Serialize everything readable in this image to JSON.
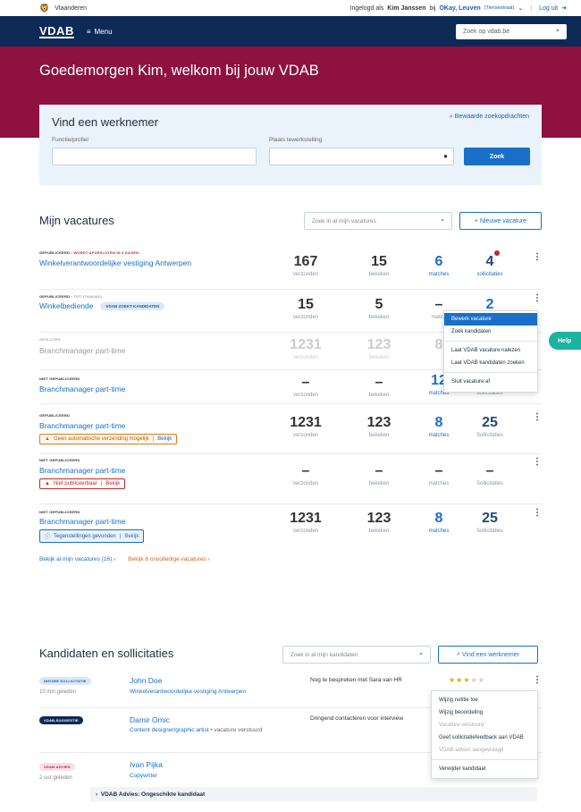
{
  "topbar": {
    "brand": "Vlaanderen",
    "logged_in_prefix": "Ingelogd als",
    "user": "Kim Janssen",
    "at": "bij",
    "org": "OKay, Leuven",
    "org_sub": "(Tiensestraat)",
    "logout": "Log uit"
  },
  "nav": {
    "logo": "VDAB",
    "menu": "Menu",
    "search_placeholder": "Zoek op vdab.be"
  },
  "hero": {
    "greeting": "Goedemorgen Kim, welkom bij jouw VDAB"
  },
  "search": {
    "title": "Vind een werknemer",
    "saved": "Bewaarde zoekopdrachten",
    "function_label": "Functie/profiel",
    "place_label": "Plaats tewerkstelling",
    "button": "Zoek"
  },
  "vacatures": {
    "title": "Mijn vacatures",
    "search_placeholder": "Zoek in al mijn vacatures",
    "new_button": "+ Nieuwe vacature",
    "rows": [
      {
        "status": "GEPUBLICEERD",
        "status_extra": "• WORDT AFGESLOTEN IN 4 DAGEN",
        "title": "Winkelverantwoordelijke vestiging Antwerpen",
        "verzonden": "167",
        "bekeken": "15",
        "matches": "6",
        "sollicitaties": "4",
        "l1": "verzonden",
        "l2": "bekeken",
        "l3": "matches",
        "l4": "sollicitaties"
      },
      {
        "status": "GEPUBLICEERD",
        "status_extra": "• TOT 17/04/2021",
        "title": "Winkelbediende",
        "badge": "VDAB ZOEKT KANDIDATEN",
        "verzonden": "15",
        "bekeken": "5",
        "matches": "–",
        "sollicitaties": "2",
        "l1": "verzonden",
        "l2": "bekeken",
        "l3": "match"
      },
      {
        "status": "GESLOTEN",
        "title": "Branchmanager part-time",
        "verzonden": "1231",
        "bekeken": "123",
        "matches": "8",
        "l1": "verzonden",
        "l2": "bekeken"
      },
      {
        "status": "NIET GEPUBLICEERD",
        "title": "Branchmanager part-time",
        "verzonden": "–",
        "bekeken": "–",
        "matches": "12",
        "l1": "verzonden",
        "l2": "bekeken",
        "l3": "matches",
        "l4": "sollicitaties"
      },
      {
        "status": "GEPUBLICEERD",
        "title": "Branchmanager part-time",
        "warning": "Geen automatische verzending mogelijk",
        "warning_link": "Bekijk",
        "verzonden": "1231",
        "bekeken": "123",
        "matches": "8",
        "sollicitaties": "25",
        "l1": "verzonden",
        "l2": "bekeken",
        "l3": "matches",
        "l4": "Sollicitaties"
      },
      {
        "status": "NIET GEPUBLICEERD",
        "title": "Branchmanager part-time",
        "warning": "Niet publiceerbaar",
        "warning_link": "Bekijk",
        "verzonden": "–",
        "bekeken": "–",
        "matches": "–",
        "sollicitaties": "–",
        "l1": "verzonden",
        "l2": "bekeken",
        "l3": "matches",
        "l4": "Sollicitaties"
      },
      {
        "status": "NIET GEPUBLICEERD",
        "title": "Branchmanager part-time",
        "warning": "Tegenstellingen gevonden",
        "warning_link": "Bekijk",
        "verzonden": "1231",
        "bekeken": "123",
        "matches": "8",
        "sollicitaties": "25",
        "l1": "verzonden",
        "l2": "bekeken",
        "l3": "matches",
        "l4": "Sollicitaties"
      }
    ],
    "menu": [
      "Bewerk vacature",
      "Zoek kandidaten",
      "Laat VDAB vacature nalezen",
      "Laat VDAB kandidaten zoeken",
      "Sluit vacature af"
    ],
    "link_all": "Bekijk al mijn vacatures (16)",
    "link_incomplete": "Bekijk 6 onvolledige vacatures"
  },
  "help": "Help",
  "kandidaten": {
    "title": "Kandidaten en sollicitaties",
    "search_placeholder": "Zoek in al mijn kandidaten",
    "find_button": "Vind een werknemer",
    "rows": [
      {
        "badge": "NIEUWE SOLLICITATIE",
        "time": "10 min geleden",
        "name": "John Doe",
        "job": "Winkelverantwoordelijke vestiging Antwerpen",
        "note": "Nog te bespreken met Sara van HR",
        "rating": 3
      },
      {
        "badge": "VDAB-SUGGESTIE",
        "name": "Damir Omic",
        "job": "Content designer/graphic artist",
        "job_extra": "vacature verstuurd",
        "note": "Dringend contacteren voor interview"
      },
      {
        "badge": "VDAB-ADVIES",
        "time": "2 uur geleden",
        "name": "Ivan Pijka",
        "job": "Copywriter"
      }
    ],
    "menu": [
      "Wijzig notitie toe",
      "Wijzig beoordeling",
      "Vacature verstuurd",
      "Geef sollicitatiefeedback aan VDAB",
      "VDAB-advies aangevraagd",
      "Verwijder kandidaat"
    ],
    "advice": "VDAB Advies: Ongeschikte kandidaat"
  }
}
